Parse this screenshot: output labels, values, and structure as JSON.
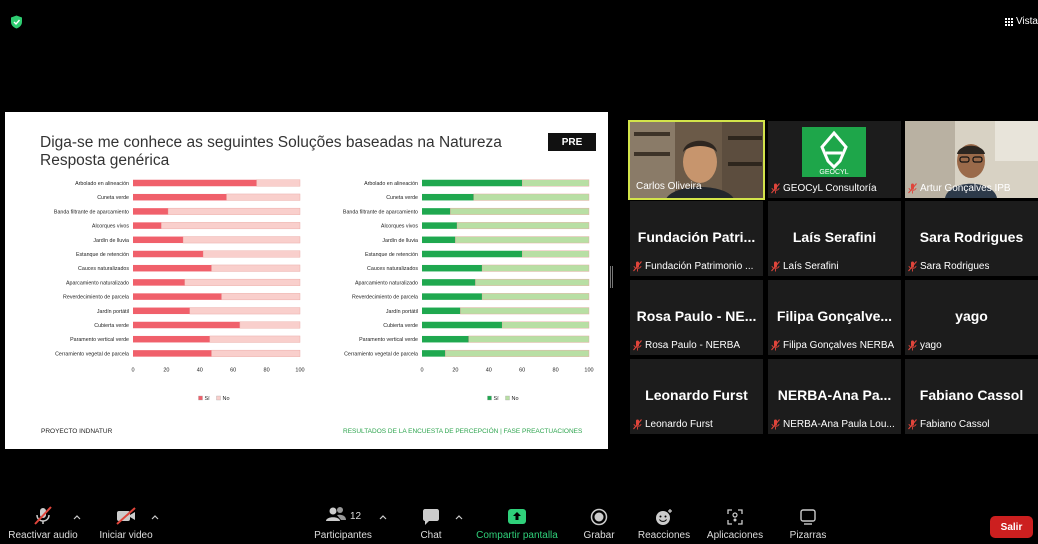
{
  "top": {
    "view_label": "Vista"
  },
  "slide": {
    "title_line1": "Diga-se me conhece as seguintes Soluções baseadas na Natureza",
    "title_line2": "Resposta genérica",
    "badge": "PRE",
    "footer_left": "PROYECTO INDNATUR",
    "footer_right": "RESULTADOS DE LA ENCUESTA DE PERCEPCIÓN | FASE PREACTUACIONES"
  },
  "chart_data": [
    {
      "type": "bar",
      "orientation": "horizontal",
      "stacked": true,
      "categories": [
        "Arbolado en alineación",
        "Cuneta verde",
        "Banda filtrante de aparcamiento",
        "Alcorques vivos",
        "Jardín de lluvia",
        "Estanque de retención",
        "Cauces naturalizados",
        "Aparcamiento naturalizado",
        "Reverdecimiento de parcela",
        "Jardín portátil",
        "Cubierta verde",
        "Paramento vertical verde",
        "Cerramiento vegetal de parcela"
      ],
      "series": [
        {
          "name": "Sí",
          "color": "#f0606b",
          "values": [
            74,
            56,
            21,
            17,
            30,
            42,
            47,
            31,
            53,
            34,
            64,
            46,
            47
          ]
        },
        {
          "name": "No",
          "color": "#f9cfcc",
          "values": [
            26,
            44,
            79,
            83,
            70,
            58,
            53,
            69,
            47,
            66,
            36,
            54,
            53
          ]
        }
      ],
      "xlim": [
        0,
        100
      ],
      "xticks": [
        "0",
        "20",
        "40",
        "60",
        "80",
        "100"
      ],
      "legend": "bottom"
    },
    {
      "type": "bar",
      "orientation": "horizontal",
      "stacked": true,
      "categories": [
        "Arbolado en alineación",
        "Cuneta verde",
        "Banda filtrante de aparcamiento",
        "Alcorques vivos",
        "Jardín de lluvia",
        "Estanque de retención",
        "Cauces naturalizados",
        "Aparcamiento naturalizado",
        "Reverdecimiento de parcela",
        "Jardín portátil",
        "Cubierta verde",
        "Paramento vertical verde",
        "Cerramiento vegetal de parcela"
      ],
      "series": [
        {
          "name": "Sí",
          "color": "#1fa84f",
          "values": [
            60,
            31,
            17,
            21,
            20,
            60,
            36,
            32,
            36,
            23,
            48,
            28,
            14
          ]
        },
        {
          "name": "No",
          "color": "#b8dfa4",
          "values": [
            40,
            69,
            83,
            79,
            80,
            40,
            64,
            68,
            64,
            77,
            52,
            72,
            86
          ]
        }
      ],
      "xlim": [
        0,
        100
      ],
      "xticks": [
        "0",
        "20",
        "40",
        "60",
        "80",
        "100"
      ],
      "legend": "bottom"
    }
  ],
  "participants": [
    {
      "big": "",
      "caption": "Carlos Oliveira",
      "muted": false,
      "kind": "video-man",
      "active": true
    },
    {
      "big": "",
      "caption": "GEOCyL Consultoría",
      "muted": true,
      "kind": "logo",
      "active": false
    },
    {
      "big": "",
      "caption": "Artur Gonçalves IPB",
      "muted": true,
      "kind": "video-glasses",
      "active": false
    },
    {
      "big": "Fundación Patri...",
      "caption": "Fundación Patrimonio ...",
      "muted": true,
      "kind": "name",
      "active": false
    },
    {
      "big": "Laís Serafini",
      "caption": "Laís Serafini",
      "muted": true,
      "kind": "name",
      "active": false
    },
    {
      "big": "Sara Rodrigues",
      "caption": "Sara Rodrigues",
      "muted": true,
      "kind": "name",
      "active": false
    },
    {
      "big": "Rosa Paulo - NE...",
      "caption": "Rosa Paulo - NERBA",
      "muted": true,
      "kind": "name",
      "active": false
    },
    {
      "big": "Filipa Gonçalve...",
      "caption": "Filipa Gonçalves NERBA",
      "muted": true,
      "kind": "name",
      "active": false
    },
    {
      "big": "yago",
      "caption": "yago",
      "muted": true,
      "kind": "name",
      "active": false
    },
    {
      "big": "Leonardo Furst",
      "caption": "Leonardo Furst",
      "muted": true,
      "kind": "name",
      "active": false
    },
    {
      "big": "NERBA-Ana Pa...",
      "caption": "NERBA-Ana Paula Lou...",
      "muted": true,
      "kind": "name",
      "active": false
    },
    {
      "big": "Fabiano Cassol",
      "caption": "Fabiano Cassol",
      "muted": true,
      "kind": "name",
      "active": false
    }
  ],
  "logo_text": "GEOCYL",
  "toolbar": {
    "unmute": "Reactivar audio",
    "start_video": "Iniciar video",
    "participants": "Participantes",
    "participants_count": "12",
    "chat": "Chat",
    "share": "Compartir pantalla",
    "record": "Grabar",
    "reactions": "Reacciones",
    "apps": "Aplicaciones",
    "boards": "Pizarras",
    "exit": "Salir"
  },
  "colors": {
    "share_green": "#2fd07a",
    "exit_red": "#cc1f1f",
    "active_border": "#d3e44a",
    "muted_red": "#e0453b"
  }
}
